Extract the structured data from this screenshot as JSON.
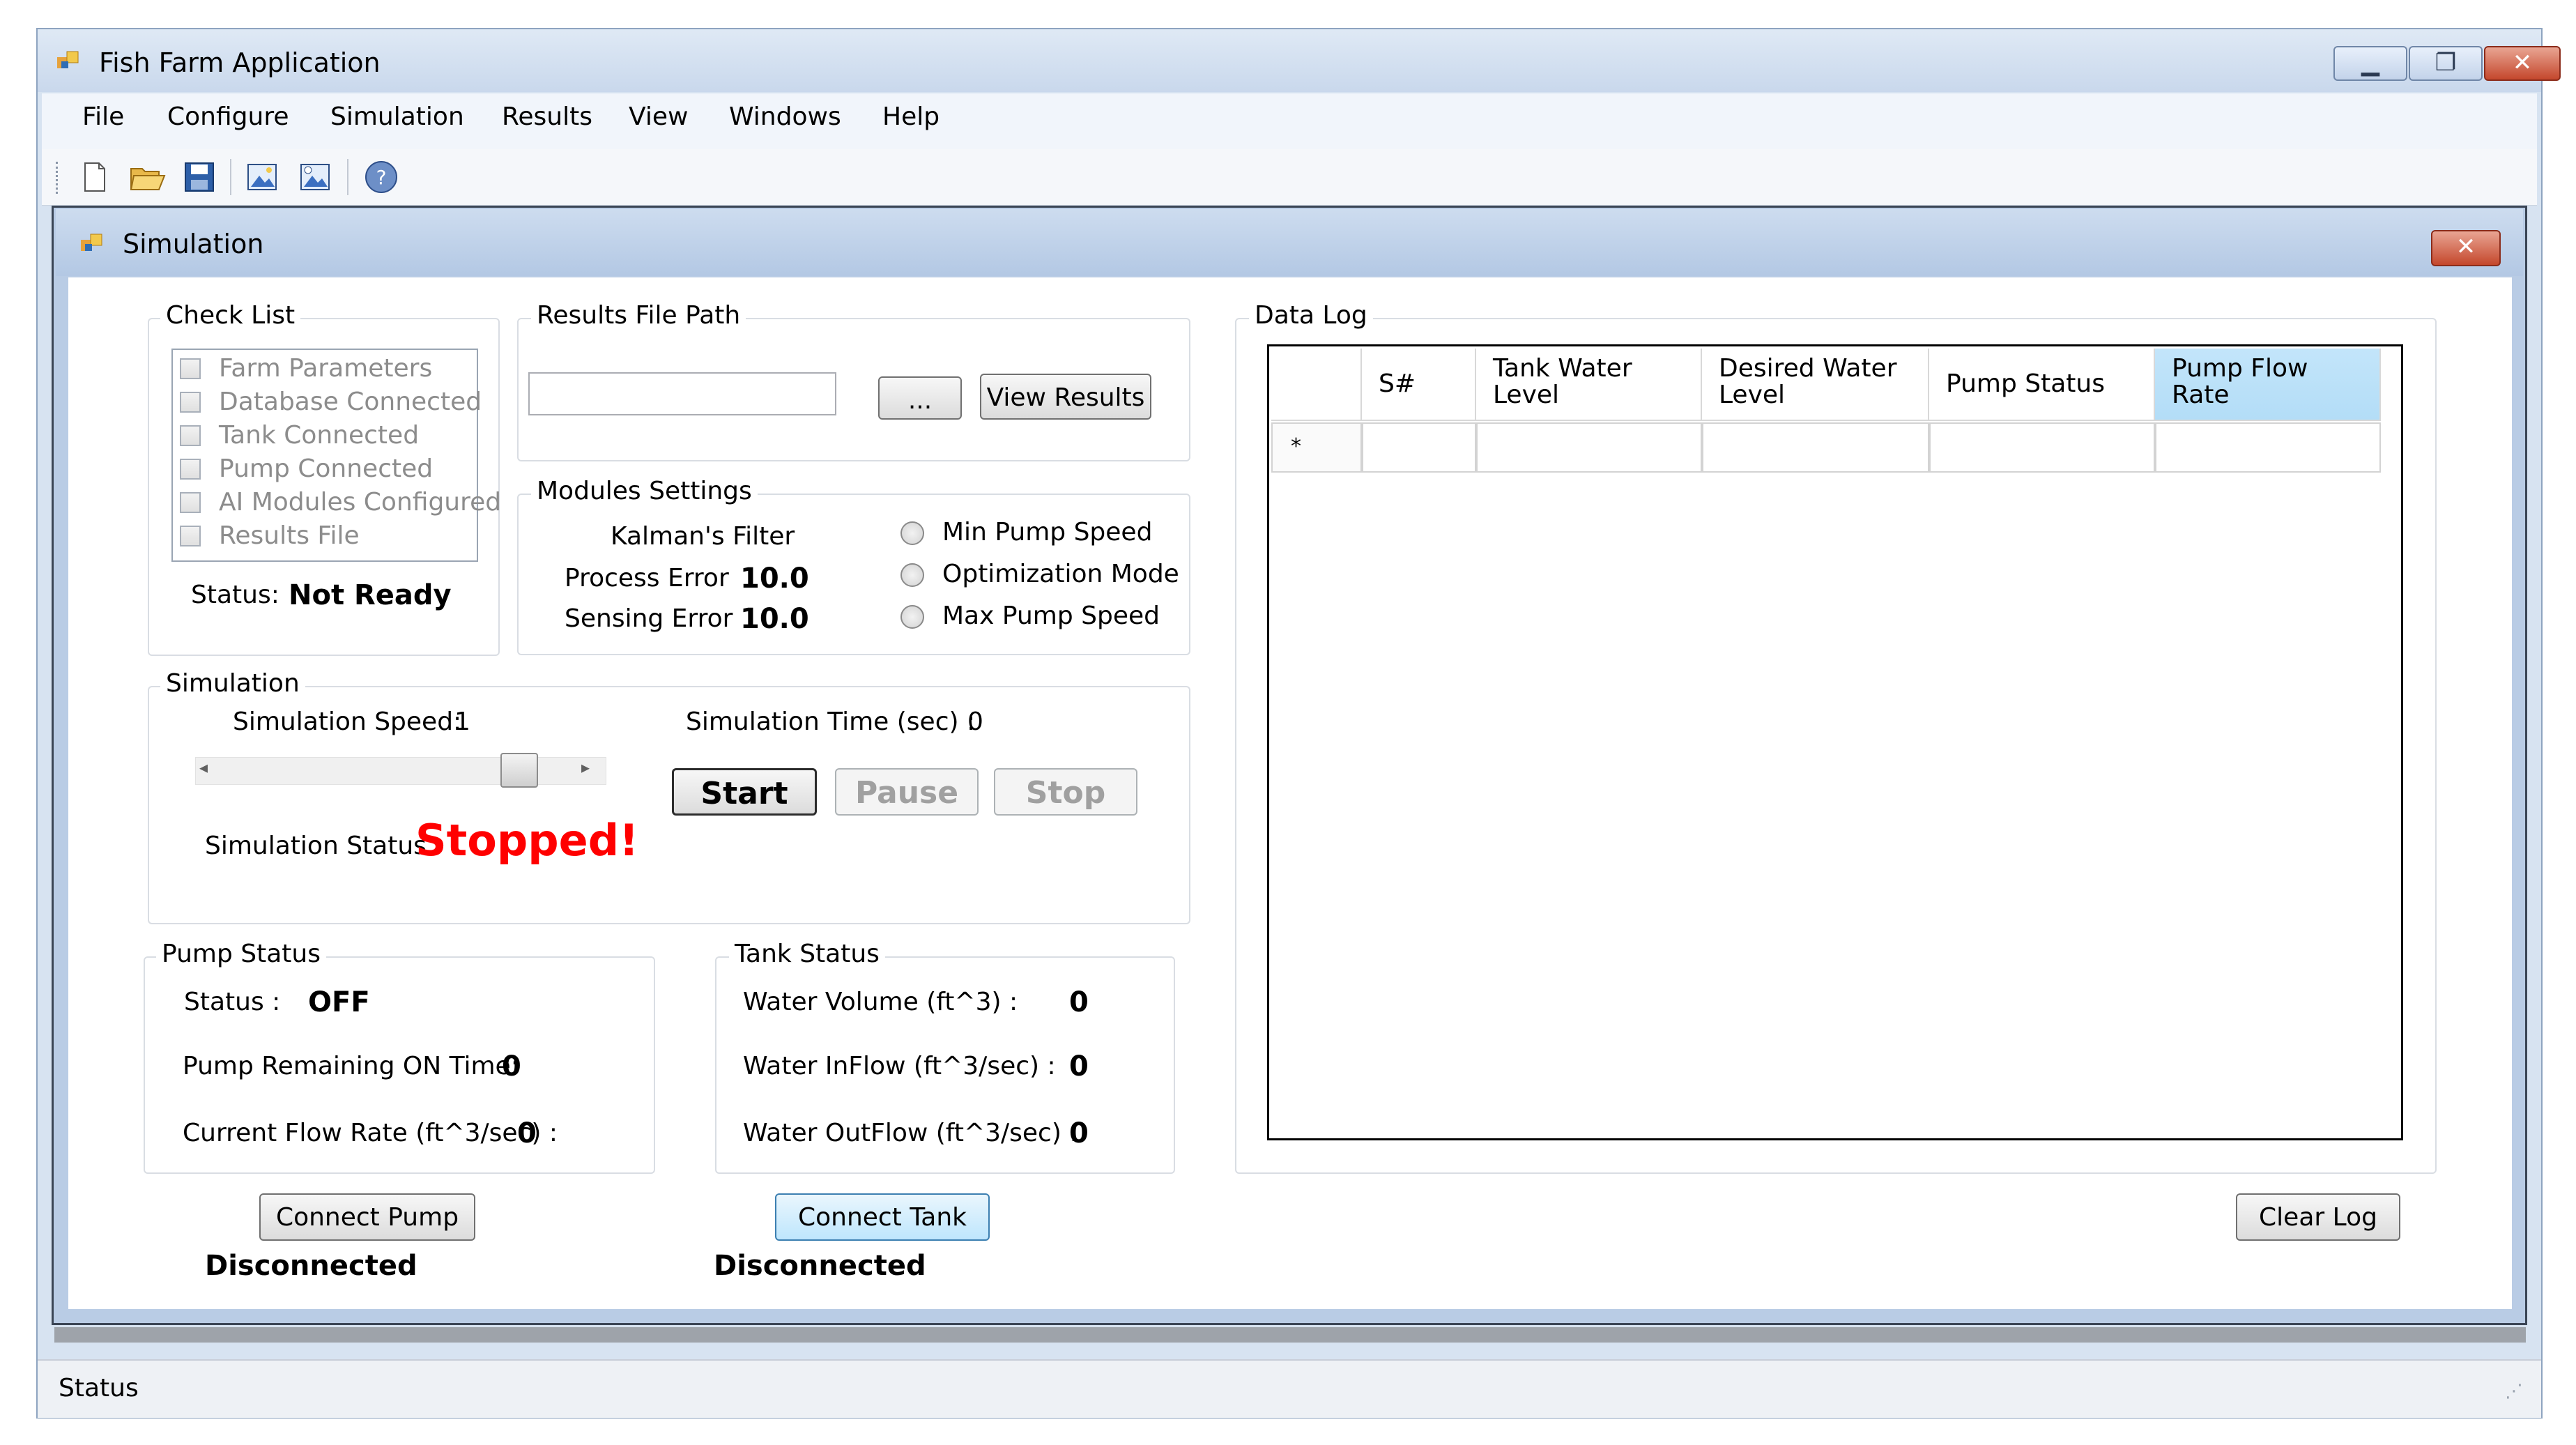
{
  "window": {
    "title": "Fish Farm Application"
  },
  "menu": [
    "File",
    "Configure",
    "Simulation",
    "Results",
    "View",
    "Windows",
    "Help"
  ],
  "toolbar_icons": [
    "new-file-icon",
    "open-folder-icon",
    "save-icon",
    "image-icon",
    "image-export-icon",
    "help-icon"
  ],
  "child": {
    "title": "Simulation"
  },
  "checklist": {
    "label": "Check List",
    "items": [
      "Farm Parameters",
      "Database Connected",
      "Tank Connected",
      "Pump Connected",
      "AI Modules Configured",
      "Results File"
    ],
    "status_label": "Status:",
    "status_value": "Not Ready"
  },
  "results": {
    "label": "Results File Path",
    "path_value": "",
    "browse_label": "...",
    "view_label": "View Results"
  },
  "modules": {
    "label": "Modules Settings",
    "filter_label": "Kalman's Filter",
    "process_error_label": "Process Error",
    "process_error_value": "10.0",
    "sensing_error_label": "Sensing Error",
    "sensing_error_value": "10.0",
    "radios": [
      "Min Pump Speed",
      "Optimization Mode",
      "Max Pump Speed"
    ]
  },
  "simulation": {
    "label": "Simulation",
    "speed_label": "Simulation Speed:",
    "speed_value": "1",
    "time_label": "Simulation Time (sec) :",
    "time_value": "0",
    "start_label": "Start",
    "pause_label": "Pause",
    "stop_label": "Stop",
    "status_label": "Simulation Status",
    "status_value": "Stopped!",
    "speed_slider_level": 0.82
  },
  "pump": {
    "label": "Pump Status",
    "status_label": "Status :",
    "status_value": "OFF",
    "remaining_label": "Pump Remaining ON Time:",
    "remaining_value": "0",
    "flow_label": "Current Flow Rate (ft^3/sec) :",
    "flow_value": "0",
    "connect_label": "Connect Pump",
    "connection_status": "Disconnected"
  },
  "tank": {
    "label": "Tank Status",
    "volume_label": "Water Volume (ft^3) :",
    "volume_value": "0",
    "inflow_label": "Water InFlow (ft^3/sec) :",
    "inflow_value": "0",
    "outflow_label": "Water OutFlow (ft^3/sec) :",
    "outflow_value": "0",
    "connect_label": "Connect Tank",
    "connection_status": "Disconnected"
  },
  "datalog": {
    "label": "Data Log",
    "columns": [
      "S#",
      "Tank Water Level",
      "Desired Water Level",
      "Pump Status",
      "Pump Flow Rate"
    ],
    "new_row_marker": "*",
    "clear_label": "Clear Log"
  },
  "statusbar": {
    "text": "Status"
  },
  "colors": {
    "stopped": "#ff0000",
    "selected_header": "#bfe3f9"
  }
}
